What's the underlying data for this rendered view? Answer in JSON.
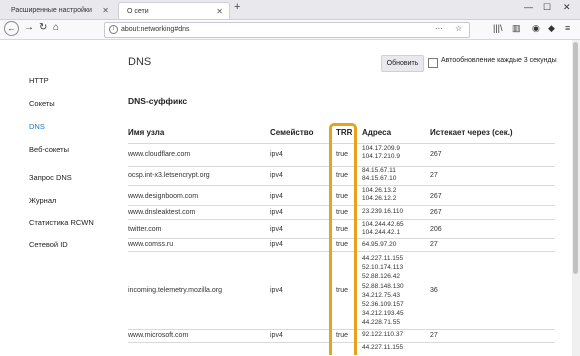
{
  "tabs": [
    {
      "label": "Расширенные настройки"
    },
    {
      "label": "О сети"
    }
  ],
  "url": "about:networking#dns",
  "sidebar": [
    "HTTP",
    "Сокеты",
    "DNS",
    "Веб-сокеты",
    "Запрос DNS",
    "Журнал",
    "Статистика RCWN",
    "Сетевой ID"
  ],
  "main": {
    "title": "DNS",
    "refresh_button": "Обновить",
    "auto_refresh_label": "Автообновление каждые 3 секунды",
    "suffix_heading": "DNS-суффикс"
  },
  "table": {
    "headers": [
      "Имя узла",
      "Семейство",
      "TRR",
      "Адреса",
      "Истекает через (сек.)"
    ],
    "rows": [
      {
        "host": "www.cloudflare.com",
        "family": "ipv4",
        "trr": "true",
        "addresses": [
          "104.17.209.9",
          "104.17.210.9"
        ],
        "expires": "267"
      },
      {
        "host": "ocsp.int-x3.letsencrypt.org",
        "family": "ipv4",
        "trr": "true",
        "addresses": [
          "84.15.67.11",
          "84.15.67.10"
        ],
        "expires": "27"
      },
      {
        "host": "www.designboom.com",
        "family": "ipv4",
        "trr": "true",
        "addresses": [
          "104.26.13.2",
          "104.26.12.2"
        ],
        "expires": "267"
      },
      {
        "host": "www.dnsleaktest.com",
        "family": "ipv4",
        "trr": "true",
        "addresses": [
          "23.239.16.110"
        ],
        "expires": "267"
      },
      {
        "host": "twitter.com",
        "family": "ipv4",
        "trr": "true",
        "addresses": [
          "104.244.42.65",
          "104.244.42.1"
        ],
        "expires": "206"
      },
      {
        "host": "www.comss.ru",
        "family": "ipv4",
        "trr": "true",
        "addresses": [
          "64.95.97.20"
        ],
        "expires": "27"
      },
      {
        "host": "incoming.telemetry.mozilla.org",
        "family": "ipv4",
        "trr": "true",
        "addresses": [
          "44.227.11.155",
          "52.10.174.113",
          "52.88.126.42",
          "52.88.148.130",
          "34.212.75.43",
          "52.36.109.157",
          "34.212.193.45",
          "44.228.71.55"
        ],
        "expires": "36"
      },
      {
        "host": "www.microsoft.com",
        "family": "ipv4",
        "trr": "true",
        "addresses": [
          "92.122.110.37"
        ],
        "expires": "27"
      },
      {
        "host": "",
        "family": "",
        "trr": "",
        "addresses": [
          "44.227.11.155"
        ],
        "expires": ""
      }
    ]
  },
  "colors": {
    "accent": "#1a73c7",
    "highlight": "#e8a31e"
  }
}
